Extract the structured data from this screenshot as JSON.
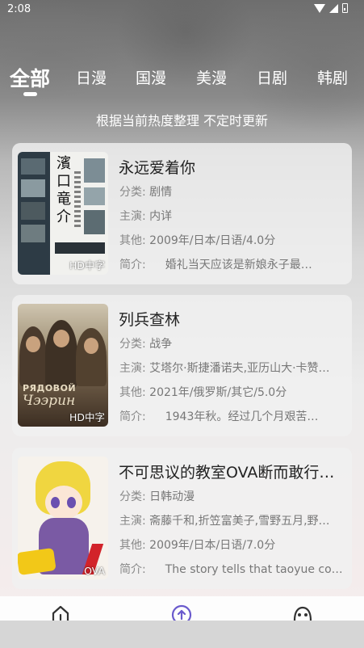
{
  "status_bar": {
    "time": "2:08",
    "icons": [
      "wifi-icon",
      "signal-icon",
      "battery-icon"
    ]
  },
  "tabs": [
    {
      "label": "全部",
      "active": true
    },
    {
      "label": "日漫",
      "active": false
    },
    {
      "label": "国漫",
      "active": false
    },
    {
      "label": "美漫",
      "active": false
    },
    {
      "label": "日剧",
      "active": false
    },
    {
      "label": "韩剧",
      "active": false
    }
  ],
  "subtitle": "根据当前热度整理 不定时更新",
  "labels": {
    "category": "分类:",
    "cast": "主演:",
    "other": "其他:",
    "intro": "简介:"
  },
  "items": [
    {
      "title": "永远爱着你",
      "badge": "HD中字",
      "category": "剧情",
      "cast": "内详",
      "other": "2009年/日本/日语/4.0分",
      "intro": "婚礼当天应该是新娘永子最…",
      "poster_text": "濱口竜介"
    },
    {
      "title": "列兵查林",
      "badge": "HD中字",
      "category": "战争",
      "cast": "艾塔尔·斯捷潘诺夫,亚历山大·卡赞…",
      "other": "2021年/俄罗斯/其它/5.0分",
      "intro": "1943年秋。经过几个月艰苦…",
      "poster_text": [
        "РЯДОВОЙ",
        "Чээрин"
      ]
    },
    {
      "title": "不可思议的教室OVA断而敢行…",
      "badge": "OVA",
      "category": "日韩动漫",
      "cast": "斋藤千和,折笠富美子,雪野五月,野…",
      "other": "2009年/日本/日语/7.0分",
      "intro": "The story tells that taoyue co…"
    }
  ],
  "bottom_nav": [
    {
      "icon": "home-icon",
      "active": false
    },
    {
      "icon": "upload-icon",
      "active": true
    },
    {
      "icon": "game-icon",
      "active": false
    }
  ],
  "colors": {
    "accent": "#6a5acd",
    "card_bg": "#f0f0f0",
    "text_dark": "#222222",
    "text_meta": "#777777"
  }
}
